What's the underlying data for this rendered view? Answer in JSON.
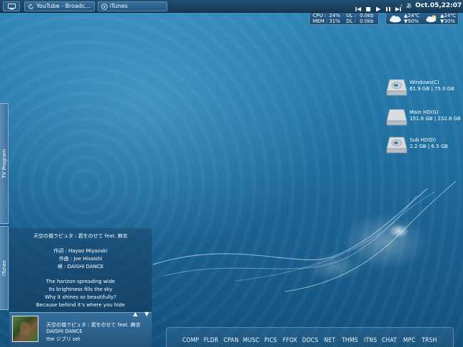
{
  "taskbar": {
    "windows": [
      {
        "label": "YouTube - Broadc..."
      },
      {
        "label": "iTunes"
      }
    ],
    "lang_indicator": "あ",
    "clock": "Oct.05,22:07"
  },
  "sys_stats": {
    "cpu_label": "CPU :",
    "cpu_value": "24%",
    "mem_label": "MEM :",
    "mem_value": "31%",
    "ul_label": "UL :",
    "ul_value": "0.0kb",
    "dl_label": "DL :",
    "dl_value": "0.0kb"
  },
  "weather": {
    "today_temp": "▲24℃",
    "today_humidity": "▼90%",
    "tomorrow_temp": "▲24℃",
    "tomorrow_humidity": "▼30%"
  },
  "drives": [
    {
      "name": "Windows(C)",
      "size": "61.9 GB | 75.0 GB"
    },
    {
      "name": "Main HD(G)",
      "size": "151.8 GB | 232.8 GB"
    },
    {
      "name": "Sub HD(D)",
      "size": "2.2 GB | 6.5 GB"
    }
  ],
  "side_tabs": {
    "tv": "TV Program",
    "itunes": "iTunes"
  },
  "lyrics": {
    "title": "天空の城ラピュタ : 君をのせて feat. 麻衣",
    "credit_lyrics": "作詞 : Hayao Miyazaki",
    "credit_music": "作曲 : Joe Hisaishi",
    "credit_vocal": "唄 : DAISHI DANCE",
    "line1": "The horizon spreading wide",
    "line2": "Its brightness fills the sky",
    "line3": "Why it shines so beautifully?",
    "line4": "Because behind it's where you hide"
  },
  "now_playing": {
    "title": "天空の城ラピュタ : 君をのせて feat. 麻衣",
    "artist": "DAISHI DANCE",
    "album": "the ジブリ set"
  },
  "dock": [
    "COMP",
    "FLDR",
    "CPAN",
    "MUSC",
    "PICS",
    "FFOX",
    "DOCS",
    "NET",
    "THMS",
    "ITNS",
    "CHAT",
    "MPC",
    "TRSH"
  ],
  "colors": {
    "background": "#1f6e9f",
    "taskbar": "#163a57"
  }
}
